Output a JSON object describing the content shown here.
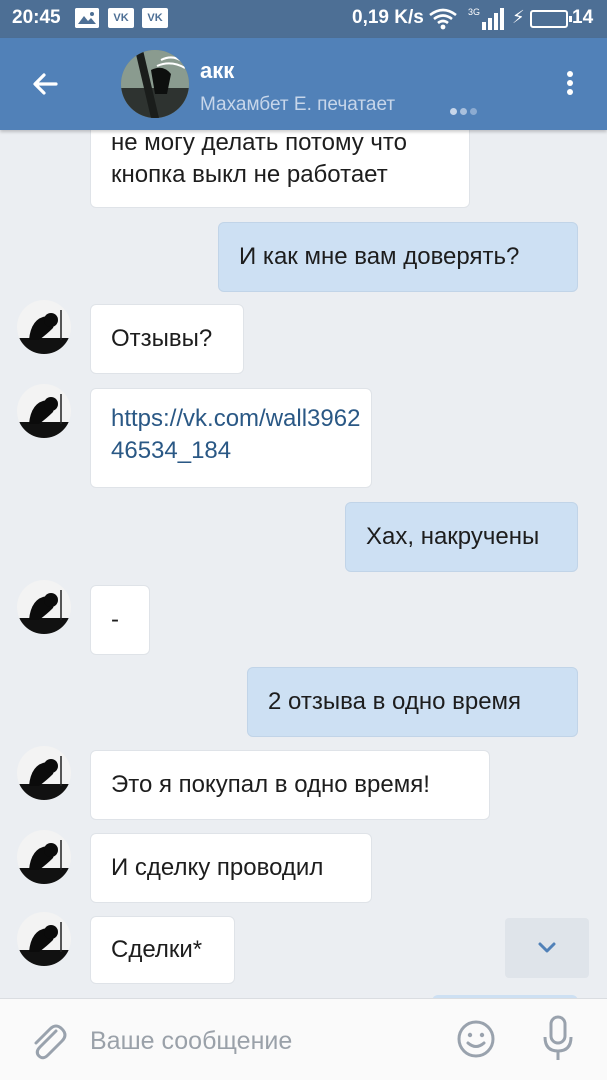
{
  "status_bar": {
    "time": "20:45",
    "notif_icons": [
      "image-icon",
      "vk-icon",
      "vk-icon"
    ],
    "vk_label": "VK",
    "speed": "0,19 K/s",
    "network": "3G",
    "battery": "14"
  },
  "header": {
    "title": "акк",
    "subtitle": "Махамбет Е. печатает",
    "typing_indicator": "typing-dots-icon"
  },
  "messages": [
    {
      "side": "in",
      "text": "не могу делать потому что кнопка выкл не работает"
    },
    {
      "side": "out",
      "text": "И как мне вам доверять?"
    },
    {
      "side": "in",
      "text": "Отзывы?"
    },
    {
      "side": "in",
      "text": "https://vk.com/wall396246534_184",
      "is_link": true
    },
    {
      "side": "out",
      "text": "Хах, накручены"
    },
    {
      "side": "in",
      "text": "-"
    },
    {
      "side": "out",
      "text": "2 отзыва в одно время"
    },
    {
      "side": "in",
      "text": "Это я покупал в одно время!"
    },
    {
      "side": "in",
      "text": "И сделку проводил"
    },
    {
      "side": "in",
      "text": "Сделки*"
    }
  ],
  "input": {
    "placeholder": "Ваше сообщение"
  },
  "colors": {
    "header": "#5181b8",
    "status_bar": "#4d6f95",
    "chat_bg": "#ebeef2",
    "outgoing_bubble": "#cde0f3",
    "incoming_bubble": "#ffffff",
    "link": "#2a5885"
  }
}
